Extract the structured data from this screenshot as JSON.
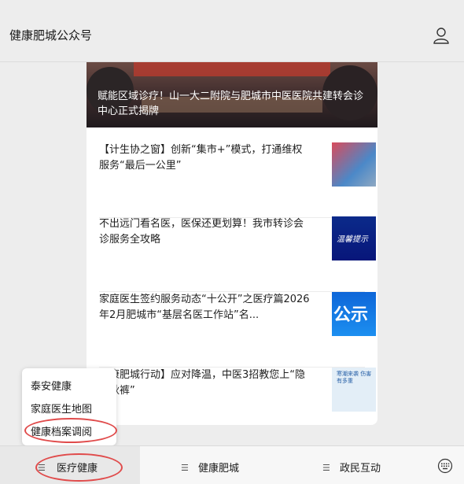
{
  "header": {
    "title": "健康肥城公众号",
    "user_icon": "user-icon"
  },
  "hero": {
    "caption": "赋能区域诊疗！山一大二附院与肥城市中医医院共建转会诊中心正式揭牌"
  },
  "articles": [
    {
      "title": "【计生协之窗】创新“集市+”模式，打通维权服务“最后一公里”",
      "thumb_text": ""
    },
    {
      "title": "不出远门看名医，医保还更划算！我市转诊会诊服务全攻略",
      "thumb_text": "温馨提示"
    },
    {
      "title": "家庭医生签约服务动态“十公开”之医疗篇2026年2月肥城市“基层名医工作站”名...",
      "thumb_text": "公示"
    },
    {
      "title": "健康肥城行动】应对降温，中医3招教您上“隐形秋裤”",
      "thumb_text": "寒潮来袭 伤害有多重"
    }
  ],
  "popup_menu": {
    "items": [
      "泰安健康",
      "家庭医生地图",
      "健康档案调阅"
    ]
  },
  "tabbar": {
    "tabs": [
      "医疗健康",
      "健康肥城",
      "政民互动"
    ],
    "keyboard_icon": "keyboard-icon"
  },
  "colors": {
    "annotation": "#e04b4b",
    "background": "#ededed"
  }
}
